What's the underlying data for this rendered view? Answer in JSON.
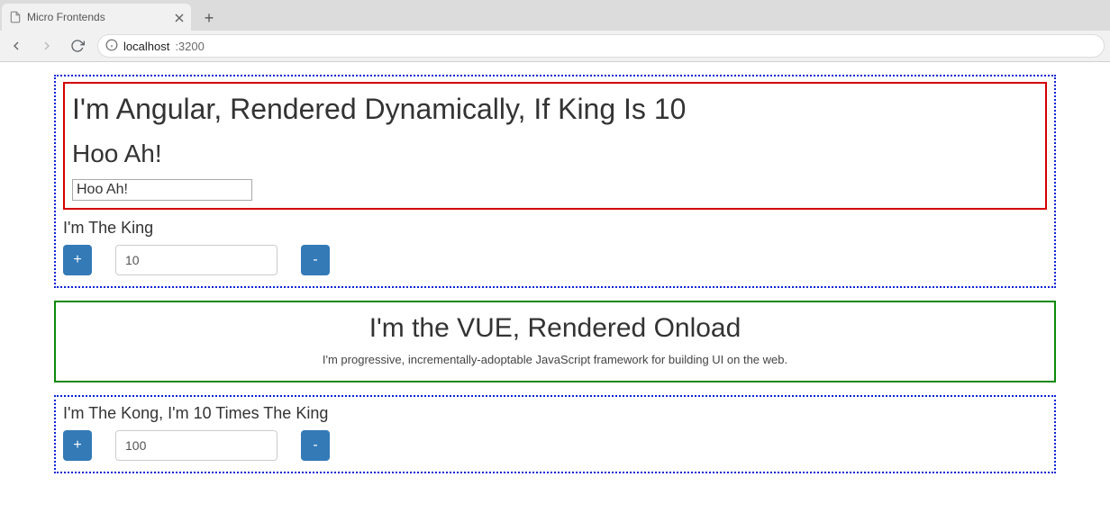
{
  "browser": {
    "tab_title": "Micro Frontends",
    "url_host": "localhost",
    "url_port": ":3200",
    "new_tab_glyph": "+"
  },
  "angular_box": {
    "heading": "I'm Angular, Rendered Dynamically, If King Is 10",
    "subheading": "Hoo Ah!",
    "input_value": "Hoo Ah!"
  },
  "king": {
    "label": "I'm The King",
    "plus": "+",
    "minus": "-",
    "value": "10"
  },
  "vue": {
    "heading": "I'm the VUE, Rendered Onload",
    "desc": "I'm progressive, incrementally-adoptable JavaScript framework for building UI on the web."
  },
  "kong": {
    "label": "I'm The Kong, I'm 10 Times The King",
    "plus": "+",
    "minus": "-",
    "value": "100"
  }
}
